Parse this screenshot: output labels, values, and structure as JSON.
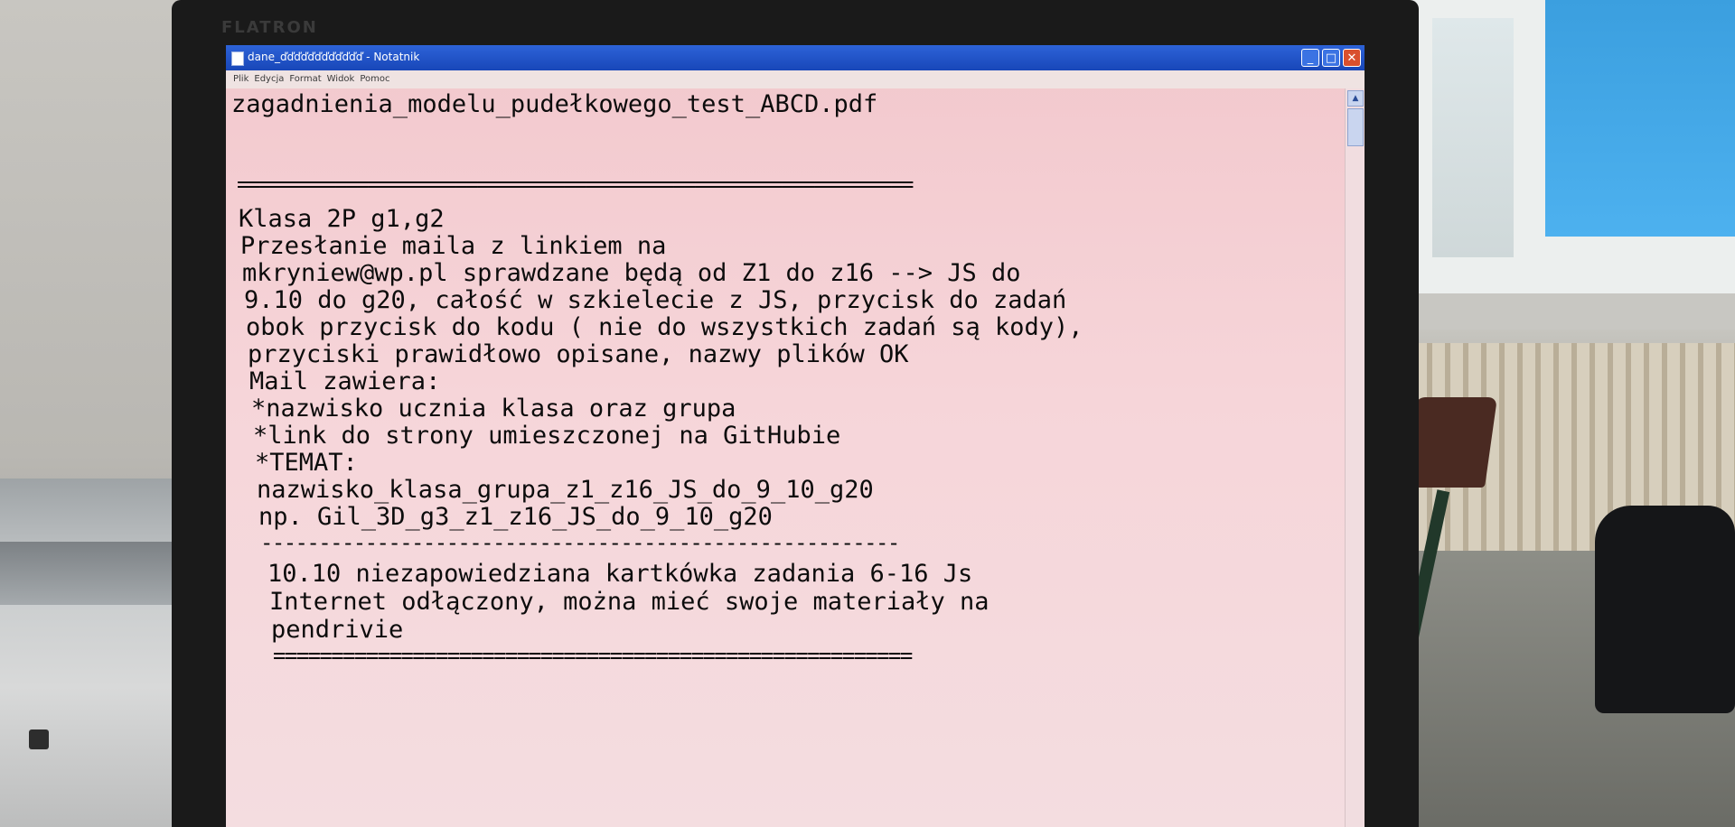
{
  "scene": {
    "monitor_brand": "FLATRON"
  },
  "window": {
    "title": "dane_ďďďďďďďďďďďď - Notatnik",
    "menu": [
      "Plik",
      "Edycja",
      "Format",
      "Widok",
      "Pomoc"
    ],
    "buttons": {
      "minimize": "_",
      "maximize": "□",
      "close": "✕"
    }
  },
  "document": {
    "lines": [
      "zagadnienia_modelu_pudełkowego_test_ABCD.pdf",
      "==============================================================",
      "Klasa 2P g1,g2",
      "Przesłanie maila z linkiem na",
      "mkryniew@wp.pl sprawdzane będą od Z1 do z16 --> JS do",
      "9.10 do g20, całość w szkielecie z JS, przycisk do zadań",
      "obok przycisk do kodu ( nie do wszystkich zadań są kody),",
      "przyciski prawidłowo opisane, nazwy plików OK",
      "Mail zawiera:",
      "*nazwisko ucznia klasa oraz grupa",
      "*link do strony umieszczonej na GitHubie",
      "*TEMAT:",
      "nazwisko_klasa_grupa_z1_z16_JS_do_9_10_g20",
      "np. Gil_3D_g3_z1_z16_JS_do_9_10_g20",
      "-------------------------------------------------------",
      "10.10 niezapowiedziana kartkówka zadania 6-16 Js",
      "Internet odłączony, można mieć swoje materiały na",
      "pendrivie",
      "======================================================="
    ]
  }
}
